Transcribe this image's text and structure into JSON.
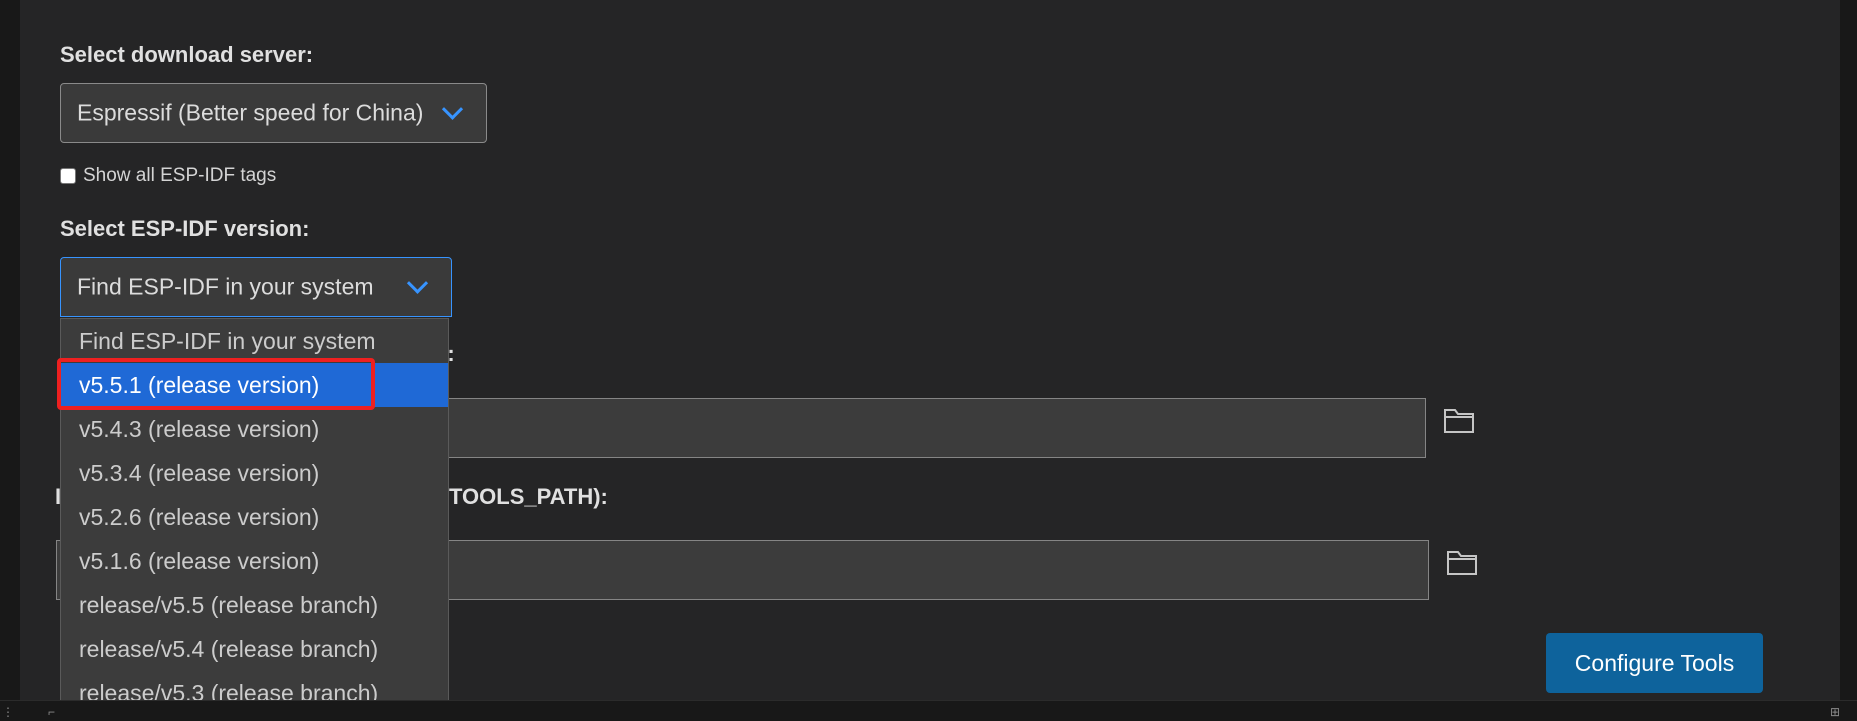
{
  "download_server": {
    "heading": "Select download server:",
    "selected": "Espressif (Better speed for China)",
    "chevron_icon": "chevron-down-icon"
  },
  "show_all_tags": {
    "label": "Show all ESP-IDF tags",
    "checked": false
  },
  "idf_version": {
    "heading": "Select ESP-IDF version:",
    "selected": "Find ESP-IDF in your system",
    "options": [
      "Find ESP-IDF in your system",
      "v5.5.1 (release version)",
      "v5.4.3 (release version)",
      "v5.3.4 (release version)",
      "v5.2.6 (release version)",
      "v5.1.6 (release version)",
      "release/v5.5 (release branch)",
      "release/v5.4 (release branch)",
      "release/v5.3 (release branch)"
    ],
    "highlighted_index": 1
  },
  "partial_labels": {
    "idf_path_suffix": "):",
    "tools_path_suffix": "TOOLS_PATH):"
  },
  "fields": {
    "idf_path_value": "",
    "tools_path_value": "",
    "folder_icon": "folder-icon"
  },
  "actions": {
    "configure_tools": "Configure Tools"
  },
  "colors": {
    "accent": "#3794ff",
    "selection": "#1f69d6",
    "button": "#0e639c",
    "highlight_box": "#ee2020",
    "background": "#252526"
  }
}
